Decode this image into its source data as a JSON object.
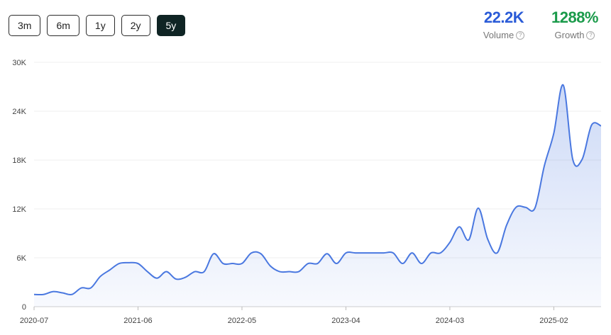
{
  "range_buttons": [
    {
      "label": "3m",
      "active": false
    },
    {
      "label": "6m",
      "active": false
    },
    {
      "label": "1y",
      "active": false
    },
    {
      "label": "2y",
      "active": false
    },
    {
      "label": "5y",
      "active": true
    }
  ],
  "stats": {
    "volume": {
      "value": "22.2K",
      "label": "Volume",
      "color": "#2a5bd7"
    },
    "growth": {
      "value": "1288%",
      "label": "Growth",
      "color": "#1a9a4a"
    }
  },
  "chart_data": {
    "type": "area",
    "ylim": [
      0,
      30000
    ],
    "y_ticks": [
      {
        "value": 0,
        "label": "0"
      },
      {
        "value": 6000,
        "label": "6K"
      },
      {
        "value": 12000,
        "label": "12K"
      },
      {
        "value": 18000,
        "label": "18K"
      },
      {
        "value": 24000,
        "label": "24K"
      },
      {
        "value": 30000,
        "label": "30K"
      }
    ],
    "x_ticks": [
      "2020-07",
      "2021-06",
      "2022-05",
      "2023-04",
      "2024-03",
      "2025-02"
    ],
    "x": [
      "2020-07",
      "2020-08",
      "2020-09",
      "2020-10",
      "2020-11",
      "2020-12",
      "2021-01",
      "2021-02",
      "2021-03",
      "2021-04",
      "2021-05",
      "2021-06",
      "2021-07",
      "2021-08",
      "2021-09",
      "2021-10",
      "2021-11",
      "2021-12",
      "2022-01",
      "2022-02",
      "2022-03",
      "2022-04",
      "2022-05",
      "2022-06",
      "2022-07",
      "2022-08",
      "2022-09",
      "2022-10",
      "2022-11",
      "2022-12",
      "2023-01",
      "2023-02",
      "2023-03",
      "2023-04",
      "2023-05",
      "2023-06",
      "2023-07",
      "2023-08",
      "2023-09",
      "2023-10",
      "2023-11",
      "2023-12",
      "2024-01",
      "2024-02",
      "2024-03",
      "2024-04",
      "2024-05",
      "2024-06",
      "2024-07",
      "2024-08",
      "2024-09",
      "2024-10",
      "2024-11",
      "2024-12",
      "2025-01",
      "2025-02",
      "2025-03",
      "2025-04",
      "2025-05"
    ],
    "values": [
      1500,
      1500,
      1850,
      1700,
      1500,
      2300,
      2300,
      3700,
      4500,
      5300,
      5400,
      5300,
      4300,
      3500,
      4300,
      3400,
      3600,
      4300,
      4300,
      6500,
      5300,
      5300,
      5300,
      6600,
      6500,
      5000,
      4300,
      4300,
      4300,
      5300,
      5300,
      6500,
      5300,
      6600,
      6600,
      6600,
      6600,
      6600,
      6600,
      5300,
      6600,
      5300,
      6600,
      6600,
      7900,
      9800,
      8200,
      12100,
      8300,
      6600,
      10000,
      12200,
      12200,
      12100,
      17300,
      21300,
      27200,
      18100,
      18100,
      22300,
      22200
    ],
    "color": "#4a78e0"
  }
}
